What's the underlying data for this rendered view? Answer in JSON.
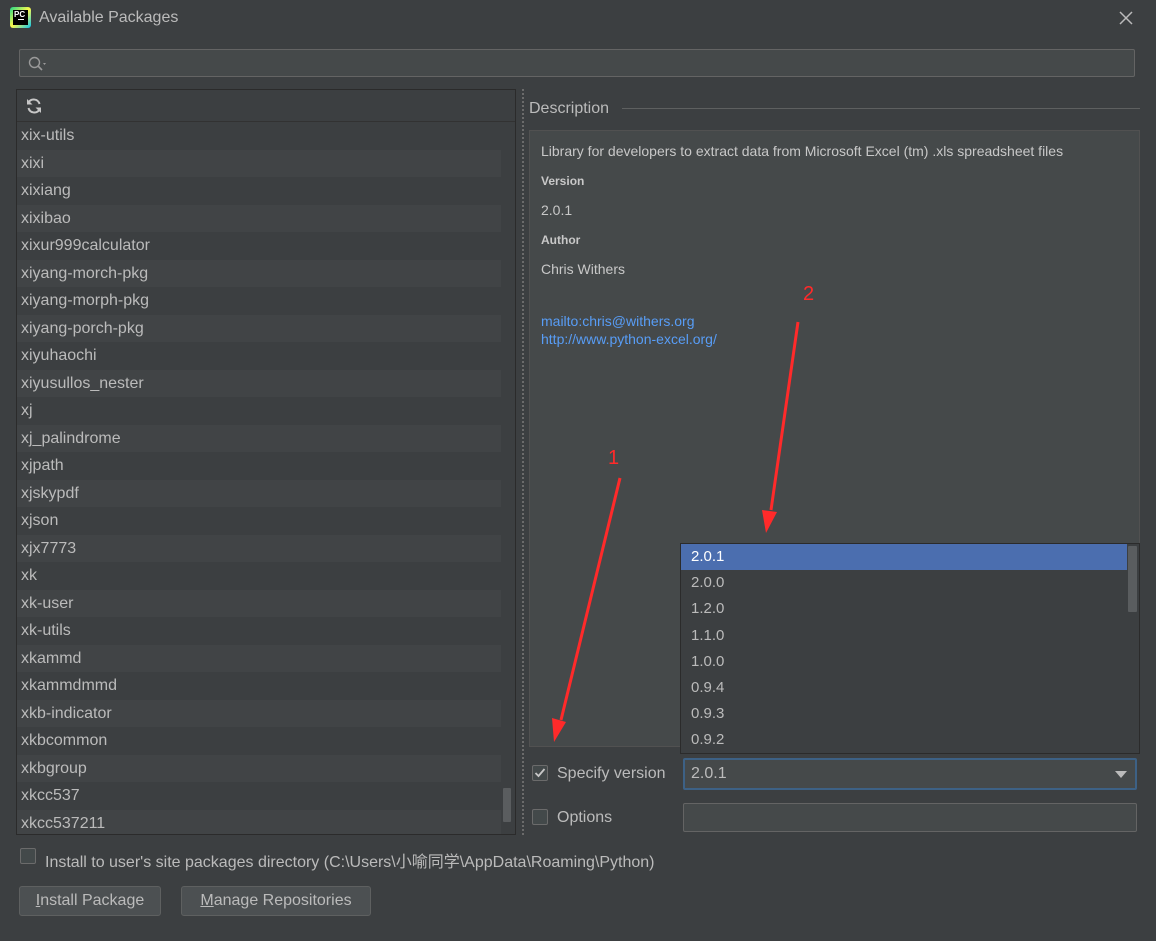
{
  "window": {
    "title": "Available Packages"
  },
  "search": {
    "placeholder": "",
    "value": ""
  },
  "packages": [
    "xix-utils",
    "xixi",
    "xixiang",
    "xixibao",
    "xixur999calculator",
    "xiyang-morch-pkg",
    "xiyang-morph-pkg",
    "xiyang-porch-pkg",
    "xiyuhaochi",
    "xiyusullos_nester",
    "xj",
    "xj_palindrome",
    "xjpath",
    "xjskypdf",
    "xjson",
    "xjx7773",
    "xk",
    "xk-user",
    "xk-utils",
    "xkammd",
    "xkammdmmd",
    "xkb-indicator",
    "xkbcommon",
    "xkbgroup",
    "xkcc537",
    "xkcc537211"
  ],
  "description": {
    "header": "Description",
    "summary": "Library for developers to extract data from Microsoft Excel (tm) .xls spreadsheet files",
    "version_label": "Version",
    "version": "2.0.1",
    "author_label": "Author",
    "author": "Chris Withers",
    "mail_link": "mailto:chris@withers.org",
    "home_link": "http://www.python-excel.org/"
  },
  "version_options": [
    "2.0.1",
    "2.0.0",
    "1.2.0",
    "1.1.0",
    "1.0.0",
    "0.9.4",
    "0.9.3",
    "0.9.2"
  ],
  "specify_version": {
    "label": "Specify version",
    "checked": true,
    "value": "2.0.1"
  },
  "options": {
    "label": "Options",
    "checked": false,
    "value": ""
  },
  "install_user_site": {
    "label": "Install to user's site packages directory (C:\\Users\\小喻同学\\AppData\\Roaming\\Python)",
    "checked": false
  },
  "buttons": {
    "install_first": "I",
    "install_rest": "nstall Package",
    "manage_first": "M",
    "manage_rest": "anage Repositories"
  },
  "annotations": {
    "arrow1": "1",
    "arrow2": "2",
    "color": "#ff2a2a"
  },
  "colors": {
    "background": "#3c3f41",
    "selection": "#4b6eaf",
    "link": "#589df6"
  }
}
